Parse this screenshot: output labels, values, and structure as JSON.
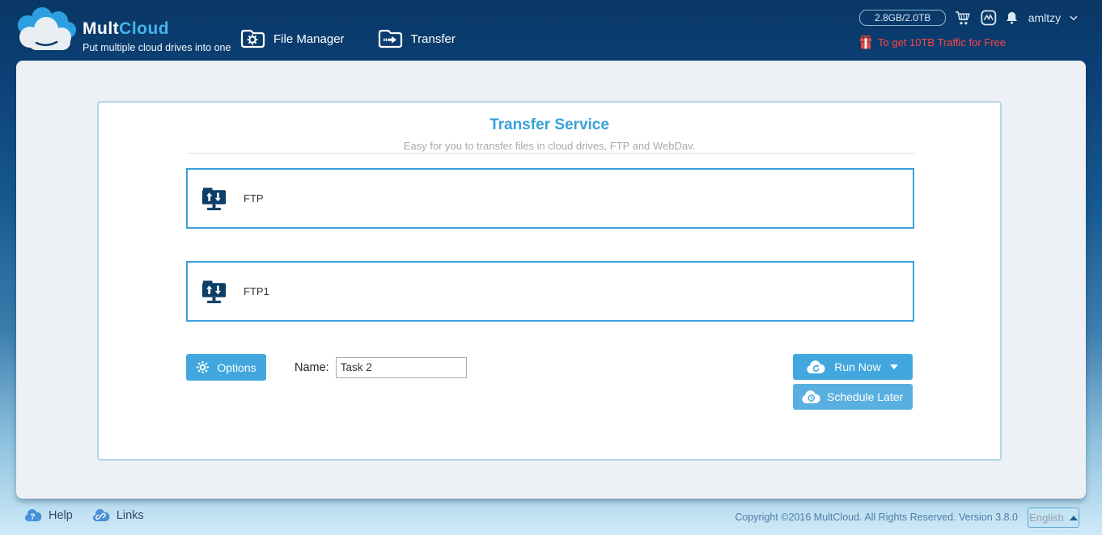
{
  "colors": {
    "accent_blue": "#41a7de",
    "title_blue": "#36a0d9",
    "promo_red": "#ff4540",
    "icon_navy": "#0c3e66",
    "box_border_blue": "#3d9fd9",
    "panel_border": "#b5d5e5"
  },
  "header": {
    "brand": {
      "name_bold": "Mult",
      "name_light": "Cloud",
      "tagline": "Put multiple cloud drives into one"
    },
    "nav": [
      {
        "label": "File Manager"
      },
      {
        "label": "Transfer"
      }
    ],
    "storage_label": "2.8GB/2.0TB",
    "username": "amltzy",
    "promo_label": "To get 10TB Traffic for Free"
  },
  "main": {
    "title": "Transfer Service",
    "subtitle": "Easy for you to transfer files in cloud drives, FTP and WebDav.",
    "connections": [
      {
        "label": "FTP"
      },
      {
        "label": "FTP1"
      }
    ],
    "options_label": "Options",
    "name_label": "Name:",
    "task_name": "Task 2",
    "run_now_label": "Run Now",
    "schedule_later_label": "Schedule Later"
  },
  "footer": {
    "help_label": "Help",
    "links_label": "Links",
    "copyright": "Copyright ©2016 MultCloud. All Rights Reserved. Version 3.8.0",
    "language": "English"
  }
}
